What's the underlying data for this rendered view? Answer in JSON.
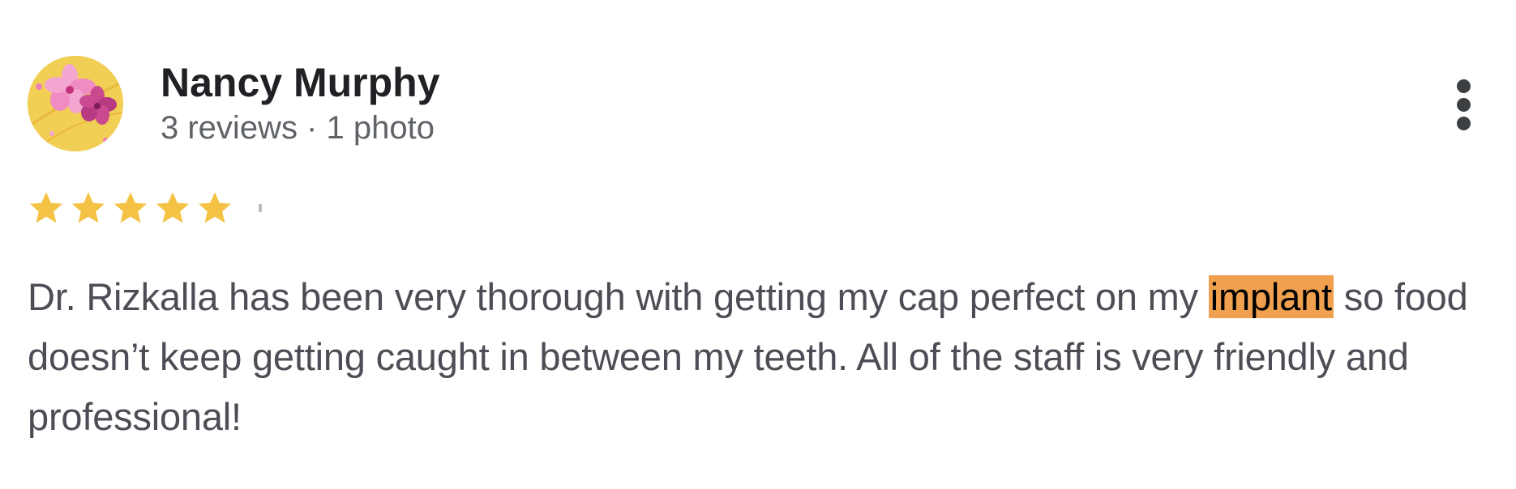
{
  "reviewer": {
    "name": "Nancy Murphy",
    "meta": "3 reviews · 1 photo"
  },
  "rating": {
    "stars": 5,
    "max": 5,
    "star_color": "#f4c244"
  },
  "review": {
    "text_before": "Dr. Rizkalla has been very thorough with getting my cap perfect on my ",
    "highlighted": "implant",
    "text_after": " so food doesn’t keep getting caught in between my teeth. All of the staff is very friendly and professional!",
    "highlight_color": "#f0a04e"
  },
  "icons": {
    "more": "more-vert-icon",
    "avatar": "flower-avatar"
  }
}
